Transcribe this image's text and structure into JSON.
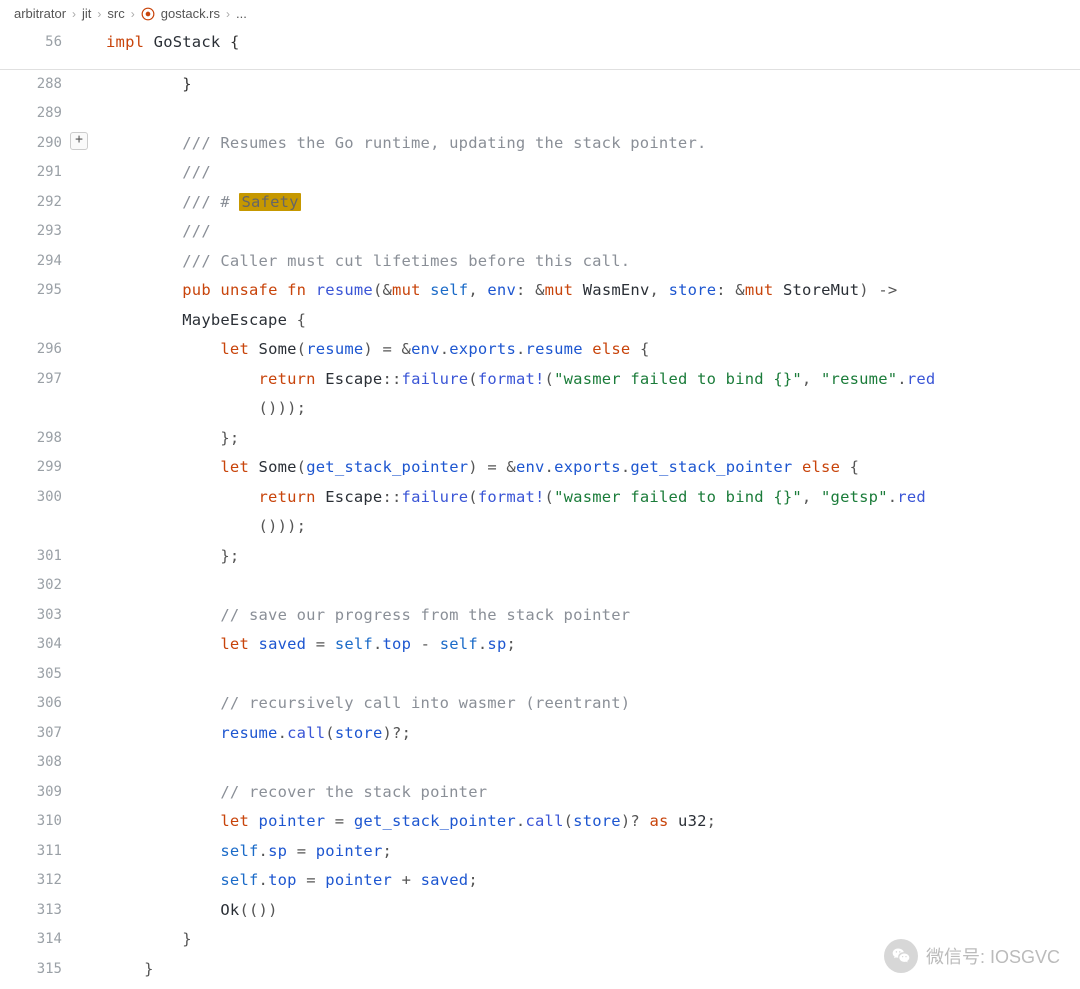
{
  "breadcrumbs": {
    "b0": "arbitrator",
    "b1": "jit",
    "b2": "src",
    "b3": "gostack.rs",
    "b4": "..."
  },
  "sticky": {
    "ln": "56",
    "code_pre": "impl ",
    "code_ty": "GoStack",
    "code_post": " {"
  },
  "watermark": {
    "label": "微信号: IOSGVC"
  },
  "plus_icon": "+",
  "lines": [
    {
      "ln": "288",
      "ind": "        ",
      "html": "}"
    },
    {
      "ln": "289",
      "ind": "",
      "html": ""
    },
    {
      "ln": "290",
      "plus": true,
      "ind": "        ",
      "c": "/// Resumes the Go runtime, updating the stack pointer."
    },
    {
      "ln": "291",
      "ind": "        ",
      "c": "///"
    },
    {
      "ln": "292",
      "ind": "        ",
      "c_pre": "/// # ",
      "c_hl": "Safety"
    },
    {
      "ln": "293",
      "ind": "        ",
      "c": "///"
    },
    {
      "ln": "294",
      "ind": "        ",
      "c": "/// Caller must cut lifetimes before this call."
    },
    {
      "ln": "295",
      "ind": "        ",
      "tok": [
        {
          "t": "pub ",
          "cls": "kw"
        },
        {
          "t": "unsafe ",
          "cls": "kw"
        },
        {
          "t": "fn ",
          "cls": "kw"
        },
        {
          "t": "resume",
          "cls": "fn"
        },
        {
          "t": "(&",
          "cls": "op"
        },
        {
          "t": "mut ",
          "cls": "kw"
        },
        {
          "t": "self",
          "cls": "sel"
        },
        {
          "t": ", ",
          "cls": "op"
        },
        {
          "t": "env",
          "cls": "id"
        },
        {
          "t": ": &",
          "cls": "op"
        },
        {
          "t": "mut ",
          "cls": "kw"
        },
        {
          "t": "WasmEnv",
          "cls": "ty"
        },
        {
          "t": ", ",
          "cls": "op"
        },
        {
          "t": "store",
          "cls": "id"
        },
        {
          "t": ": &",
          "cls": "op"
        },
        {
          "t": "mut ",
          "cls": "kw"
        },
        {
          "t": "StoreMut",
          "cls": "ty"
        },
        {
          "t": ") -> ",
          "cls": "op"
        }
      ]
    },
    {
      "ln": "",
      "ind": "        ",
      "tok": [
        {
          "t": "MaybeEscape",
          "cls": "ty"
        },
        {
          "t": " {",
          "cls": "op"
        }
      ]
    },
    {
      "ln": "296",
      "ind": "            ",
      "tok": [
        {
          "t": "let ",
          "cls": "kw"
        },
        {
          "t": "Some",
          "cls": "ty"
        },
        {
          "t": "(",
          "cls": "op"
        },
        {
          "t": "resume",
          "cls": "id"
        },
        {
          "t": ") = &",
          "cls": "op"
        },
        {
          "t": "env",
          "cls": "id"
        },
        {
          "t": ".",
          "cls": "op"
        },
        {
          "t": "exports",
          "cls": "id"
        },
        {
          "t": ".",
          "cls": "op"
        },
        {
          "t": "resume",
          "cls": "id"
        },
        {
          "t": " ",
          "cls": "op"
        },
        {
          "t": "else",
          "cls": "kw"
        },
        {
          "t": " {",
          "cls": "op"
        }
      ]
    },
    {
      "ln": "297",
      "ind": "                ",
      "tok": [
        {
          "t": "return ",
          "cls": "kw"
        },
        {
          "t": "Escape",
          "cls": "ty"
        },
        {
          "t": "::",
          "cls": "op"
        },
        {
          "t": "failure",
          "cls": "fn"
        },
        {
          "t": "(",
          "cls": "op"
        },
        {
          "t": "format!",
          "cls": "fn"
        },
        {
          "t": "(",
          "cls": "op"
        },
        {
          "t": "\"wasmer failed to bind {}\"",
          "cls": "str"
        },
        {
          "t": ", ",
          "cls": "op"
        },
        {
          "t": "\"resume\"",
          "cls": "str"
        },
        {
          "t": ".",
          "cls": "op"
        },
        {
          "t": "red",
          "cls": "fn"
        }
      ]
    },
    {
      "ln": "",
      "ind": "                ",
      "tok": [
        {
          "t": "()));",
          "cls": "op"
        }
      ]
    },
    {
      "ln": "298",
      "ind": "            ",
      "tok": [
        {
          "t": "};",
          "cls": "op"
        }
      ]
    },
    {
      "ln": "299",
      "ind": "            ",
      "tok": [
        {
          "t": "let ",
          "cls": "kw"
        },
        {
          "t": "Some",
          "cls": "ty"
        },
        {
          "t": "(",
          "cls": "op"
        },
        {
          "t": "get_stack_pointer",
          "cls": "id"
        },
        {
          "t": ") = &",
          "cls": "op"
        },
        {
          "t": "env",
          "cls": "id"
        },
        {
          "t": ".",
          "cls": "op"
        },
        {
          "t": "exports",
          "cls": "id"
        },
        {
          "t": ".",
          "cls": "op"
        },
        {
          "t": "get_stack_pointer",
          "cls": "id"
        },
        {
          "t": " ",
          "cls": "op"
        },
        {
          "t": "else",
          "cls": "kw"
        },
        {
          "t": " {",
          "cls": "op"
        }
      ]
    },
    {
      "ln": "300",
      "ind": "                ",
      "tok": [
        {
          "t": "return ",
          "cls": "kw"
        },
        {
          "t": "Escape",
          "cls": "ty"
        },
        {
          "t": "::",
          "cls": "op"
        },
        {
          "t": "failure",
          "cls": "fn"
        },
        {
          "t": "(",
          "cls": "op"
        },
        {
          "t": "format!",
          "cls": "fn"
        },
        {
          "t": "(",
          "cls": "op"
        },
        {
          "t": "\"wasmer failed to bind {}\"",
          "cls": "str"
        },
        {
          "t": ", ",
          "cls": "op"
        },
        {
          "t": "\"getsp\"",
          "cls": "str"
        },
        {
          "t": ".",
          "cls": "op"
        },
        {
          "t": "red",
          "cls": "fn"
        }
      ]
    },
    {
      "ln": "",
      "ind": "                ",
      "tok": [
        {
          "t": "()));",
          "cls": "op"
        }
      ]
    },
    {
      "ln": "301",
      "ind": "            ",
      "tok": [
        {
          "t": "};",
          "cls": "op"
        }
      ]
    },
    {
      "ln": "302",
      "ind": "",
      "html": ""
    },
    {
      "ln": "303",
      "ind": "            ",
      "c": "// save our progress from the stack pointer"
    },
    {
      "ln": "304",
      "ind": "            ",
      "tok": [
        {
          "t": "let ",
          "cls": "kw"
        },
        {
          "t": "saved",
          "cls": "id"
        },
        {
          "t": " = ",
          "cls": "op"
        },
        {
          "t": "self",
          "cls": "sel"
        },
        {
          "t": ".",
          "cls": "op"
        },
        {
          "t": "top",
          "cls": "id"
        },
        {
          "t": " - ",
          "cls": "op"
        },
        {
          "t": "self",
          "cls": "sel"
        },
        {
          "t": ".",
          "cls": "op"
        },
        {
          "t": "sp",
          "cls": "id"
        },
        {
          "t": ";",
          "cls": "op"
        }
      ]
    },
    {
      "ln": "305",
      "ind": "",
      "html": ""
    },
    {
      "ln": "306",
      "ind": "            ",
      "c": "// recursively call into wasmer (reentrant)"
    },
    {
      "ln": "307",
      "ind": "            ",
      "tok": [
        {
          "t": "resume",
          "cls": "id"
        },
        {
          "t": ".",
          "cls": "op"
        },
        {
          "t": "call",
          "cls": "fn"
        },
        {
          "t": "(",
          "cls": "op"
        },
        {
          "t": "store",
          "cls": "id"
        },
        {
          "t": ")?;",
          "cls": "op"
        }
      ]
    },
    {
      "ln": "308",
      "ind": "",
      "html": ""
    },
    {
      "ln": "309",
      "ind": "            ",
      "c": "// recover the stack pointer"
    },
    {
      "ln": "310",
      "ind": "            ",
      "tok": [
        {
          "t": "let ",
          "cls": "kw"
        },
        {
          "t": "pointer",
          "cls": "id"
        },
        {
          "t": " = ",
          "cls": "op"
        },
        {
          "t": "get_stack_pointer",
          "cls": "id"
        },
        {
          "t": ".",
          "cls": "op"
        },
        {
          "t": "call",
          "cls": "fn"
        },
        {
          "t": "(",
          "cls": "op"
        },
        {
          "t": "store",
          "cls": "id"
        },
        {
          "t": ")? ",
          "cls": "op"
        },
        {
          "t": "as ",
          "cls": "kw"
        },
        {
          "t": "u32",
          "cls": "ty"
        },
        {
          "t": ";",
          "cls": "op"
        }
      ]
    },
    {
      "ln": "311",
      "ind": "            ",
      "tok": [
        {
          "t": "self",
          "cls": "sel"
        },
        {
          "t": ".",
          "cls": "op"
        },
        {
          "t": "sp",
          "cls": "id"
        },
        {
          "t": " = ",
          "cls": "op"
        },
        {
          "t": "pointer",
          "cls": "id"
        },
        {
          "t": ";",
          "cls": "op"
        }
      ]
    },
    {
      "ln": "312",
      "ind": "            ",
      "tok": [
        {
          "t": "self",
          "cls": "sel"
        },
        {
          "t": ".",
          "cls": "op"
        },
        {
          "t": "top",
          "cls": "id"
        },
        {
          "t": " = ",
          "cls": "op"
        },
        {
          "t": "pointer",
          "cls": "id"
        },
        {
          "t": " + ",
          "cls": "op"
        },
        {
          "t": "saved",
          "cls": "id"
        },
        {
          "t": ";",
          "cls": "op"
        }
      ]
    },
    {
      "ln": "313",
      "ind": "            ",
      "tok": [
        {
          "t": "Ok",
          "cls": "ty"
        },
        {
          "t": "(())",
          "cls": "op"
        }
      ]
    },
    {
      "ln": "314",
      "ind": "        ",
      "tok": [
        {
          "t": "}",
          "cls": "op"
        }
      ]
    },
    {
      "ln": "315",
      "ind": "    ",
      "tok": [
        {
          "t": "}",
          "cls": "op"
        }
      ]
    }
  ]
}
